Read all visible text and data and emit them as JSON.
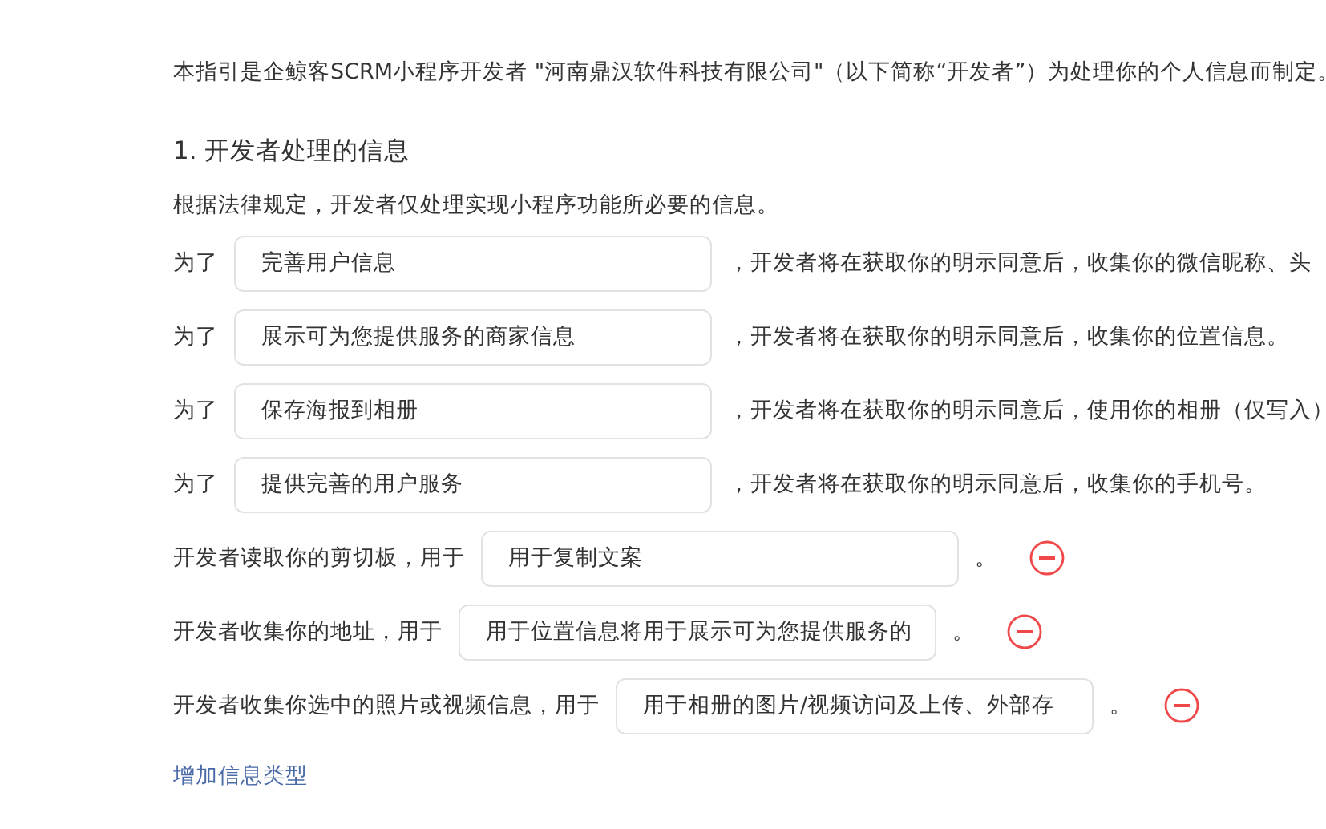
{
  "intro": "本指引是企鲸客SCRM小程序开发者 \"河南鼎汉软件科技有限公司\"（以下简称“开发者”）为处理你的个人信息而制定。",
  "section": {
    "title": "1. 开发者处理的信息",
    "note": "根据法律规定，开发者仅处理实现小程序功能所必要的信息。"
  },
  "purposes": [
    {
      "prefix": "为了",
      "value": "完善用户信息",
      "suffix": "，开发者将在获取你的明示同意后，收集你的微信昵称、头"
    },
    {
      "prefix": "为了",
      "value": "展示可为您提供服务的商家信息",
      "suffix": "，开发者将在获取你的明示同意后，收集你的位置信息。"
    },
    {
      "prefix": "为了",
      "value": "保存海报到相册",
      "suffix": "，开发者将在获取你的明示同意后，使用你的相册（仅写入）"
    },
    {
      "prefix": "为了",
      "value": "提供完善的用户服务",
      "suffix": "，开发者将在获取你的明示同意后，收集你的手机号。"
    }
  ],
  "uses": [
    {
      "label": "开发者读取你的剪切板，用于",
      "value": "用于复制文案",
      "end": "。"
    },
    {
      "label": "开发者收集你的地址，用于",
      "value": "用于位置信息将用于展示可为您提供服务的",
      "end": "。"
    },
    {
      "label": "开发者收集你选中的照片或视频信息，用于",
      "value": "用于相册的图片/视频访问及上传、外部存",
      "end": "。"
    }
  ],
  "add_link": "增加信息类型"
}
